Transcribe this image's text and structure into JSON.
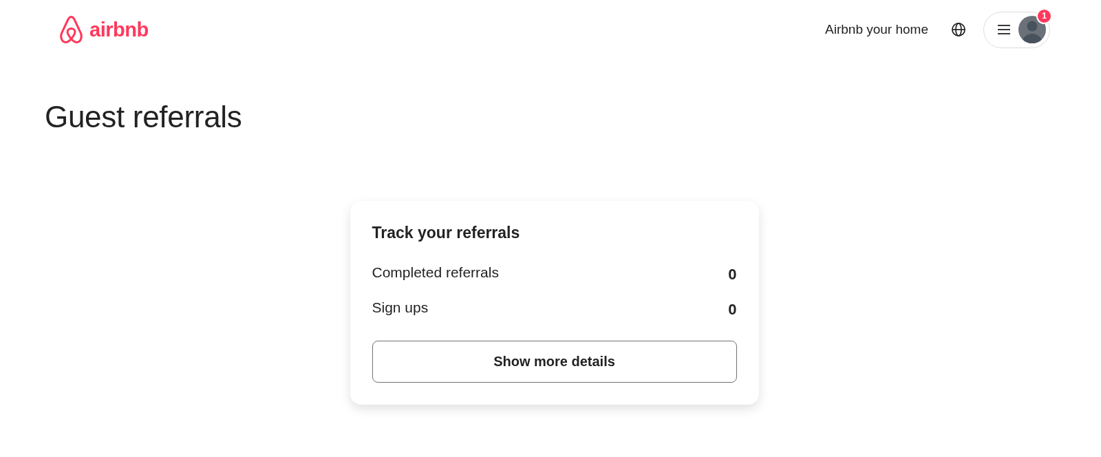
{
  "header": {
    "logo": {
      "wordmark": "airbnb"
    },
    "host_link": "Airbnb your home",
    "user_menu": {
      "badge": "1"
    }
  },
  "page_title": "Guest referrals",
  "card": {
    "title": "Track your referrals",
    "stats": [
      {
        "label": "Completed referrals",
        "value": "0"
      },
      {
        "label": "Sign ups",
        "value": "0"
      }
    ],
    "button": "Show more details"
  }
}
